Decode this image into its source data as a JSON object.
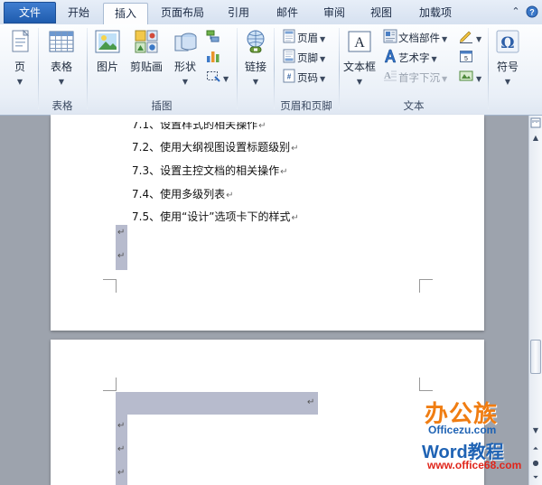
{
  "tabs": [
    "文件",
    "开始",
    "插入",
    "页面布局",
    "引用",
    "邮件",
    "审阅",
    "视图",
    "加载项"
  ],
  "active_tab": "插入",
  "ribbon": {
    "page_btn": "页",
    "table_btn": "表格",
    "table_group": "表格",
    "picture_btn": "图片",
    "clipart_btn": "剪贴画",
    "shapes_btn": "形状",
    "illustrations_group": "插图",
    "link_btn": "链接",
    "header_btn": "页眉",
    "footer_btn": "页脚",
    "pagenum_btn": "页码",
    "header_footer_group": "页眉和页脚",
    "textbox_btn": "文本框",
    "docparts_btn": "文档部件",
    "wordart_btn": "艺术字",
    "dropcap_btn": "首字下沉",
    "text_group": "文本",
    "symbol_btn": "符号"
  },
  "document": {
    "lines": [
      "7.1、设置样式的相关操作",
      "7.2、使用大纲视图设置标题级别",
      "7.3、设置主控文档的相关操作",
      "7.4、使用多级列表",
      "7.5、使用“设计”选项卡下的样式"
    ],
    "para_mark": "↵"
  },
  "watermark": {
    "brand_cn": "办公族",
    "brand_url": "Officezu.com",
    "tutorial": "Word教程",
    "site": "www.office68.com"
  },
  "colors": {
    "file_tab": "#2c68bf",
    "selection": "#b7bbcd",
    "watermark_orange": "#f07d12",
    "watermark_blue": "#1f63b4",
    "watermark_red": "#e0261b"
  }
}
